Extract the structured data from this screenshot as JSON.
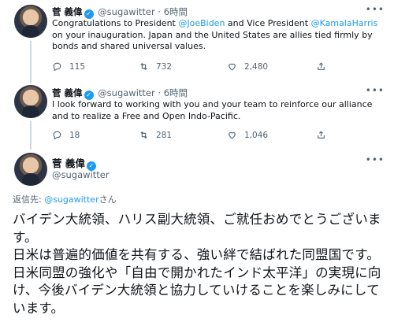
{
  "tweets": [
    {
      "name": "菅 義偉",
      "handle": "@sugawitter",
      "sep": "·",
      "time": "6時間",
      "text_parts": [
        "Congratulations to President ",
        "@JoeBiden",
        " and Vice President ",
        "@KamalaHarris",
        " on your inauguration. Japan and the United States are allies tied firmly by bonds and shared universal values."
      ],
      "replies": "115",
      "retweets": "732",
      "likes": "2,480"
    },
    {
      "name": "菅 義偉",
      "handle": "@sugawitter",
      "sep": "·",
      "time": "6時間",
      "text": "I look forward to working with you and your team to reinforce our alliance and to realize a Free and Open Indo-Pacific.",
      "replies": "18",
      "retweets": "281",
      "likes": "1,046"
    }
  ],
  "main": {
    "name": "菅 義偉",
    "handle": "@sugawitter",
    "replying_prefix": "返信先: ",
    "replying_handle": "@sugawitter",
    "replying_suffix": "さん",
    "text": "バイデン大統領、ハリス副大統領、ご就任おめでとうございます。\n日米は普遍的価値を共有する、強い絆で結ばれた同盟国です。日米同盟の強化や「自由で開かれたインド太平洋」の実現に向け、今後バイデン大統領と協力していけることを楽しみにしています。"
  },
  "icons": {
    "reply": "reply-icon",
    "retweet": "retweet-icon",
    "like": "heart-icon",
    "share": "share-icon",
    "more": "more-icon",
    "verified": "verified-badge-icon"
  },
  "colors": {
    "accent": "#1d9bf0",
    "muted": "#536471",
    "text": "#0f1419"
  }
}
